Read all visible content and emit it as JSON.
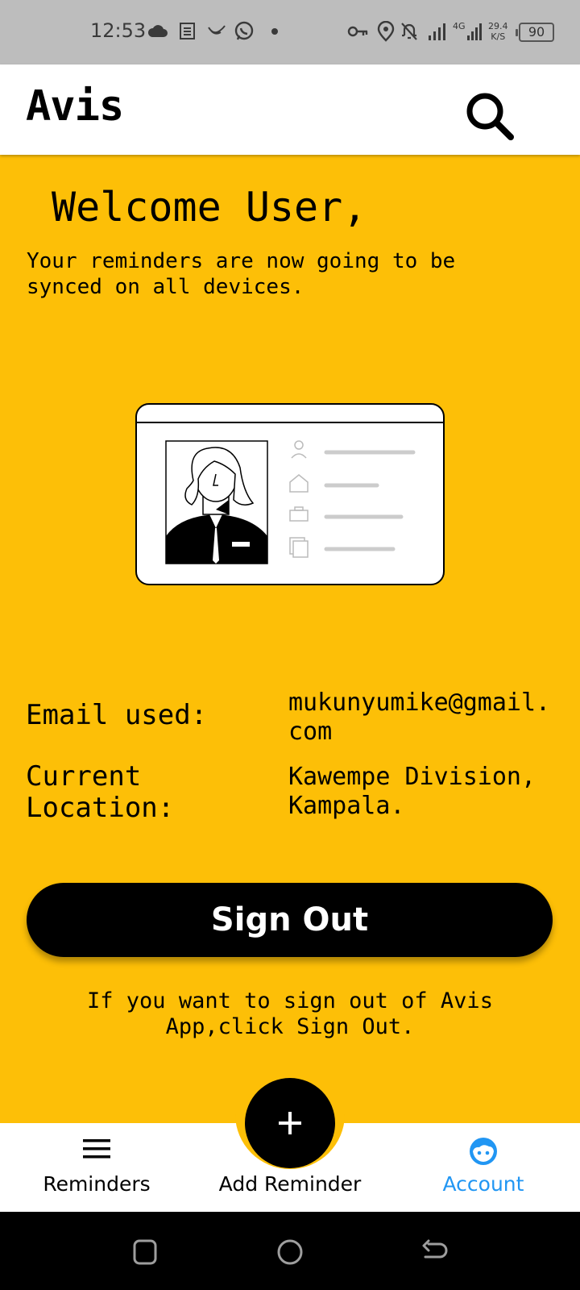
{
  "status_bar": {
    "time": "12:53",
    "network_speed_value": "29.4",
    "network_speed_unit": "K/S",
    "battery": "90",
    "network_type": "4G"
  },
  "app_bar": {
    "title": "Avis"
  },
  "account": {
    "welcome": "Welcome User,",
    "subtitle": "Your reminders are now going to be synced on all devices.",
    "email_label": "Email used:",
    "email_value": "mukunyumike@gmail.com",
    "location_label": "Current Location:",
    "location_value": "Kawempe Division, Kampala.",
    "sign_out_label": "Sign Out",
    "sign_out_hint": "If you want to sign out of Avis App,click Sign Out."
  },
  "bottom_nav": {
    "items": [
      {
        "label": "Reminders",
        "icon": "menu-icon"
      },
      {
        "label": "Add Reminder",
        "icon": "plus-icon"
      },
      {
        "label": "Account",
        "icon": "face-icon"
      }
    ],
    "active": "Account"
  },
  "colors": {
    "background": "#FDBF07",
    "active_tab": "#2196F3",
    "button": "#000000"
  }
}
